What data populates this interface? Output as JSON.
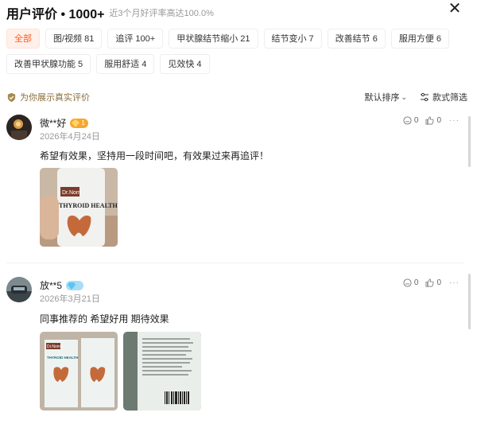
{
  "header": {
    "title": "用户评价 • 1000+",
    "subtitle": "近3个月好评率高达100.0%",
    "close_icon": "close-icon"
  },
  "tags": [
    {
      "label": "全部",
      "active": true
    },
    {
      "label": "图/视频 81"
    },
    {
      "label": "追评 100+"
    },
    {
      "label": "甲状腺结节缩小 21"
    },
    {
      "label": "结节变小 7"
    },
    {
      "label": "改善结节 6"
    },
    {
      "label": "服用方便 6"
    },
    {
      "label": "改善甲状腺功能 5"
    },
    {
      "label": "服用舒适 4"
    },
    {
      "label": "见效快 4"
    }
  ],
  "verify_text": "为你展示真实评价",
  "sort_label": "默认排序",
  "filter_label": "款式筛选",
  "reviews": [
    {
      "username": "微**好",
      "badge": "1",
      "date": "2026年4月24日",
      "text": "希望有效果，坚持用一段时间吧，有效果过来再追评！",
      "dislike_count": "0",
      "like_count": "0",
      "photos": [
        {
          "brand": "Dr.Nom",
          "text": "THYROID HEALTH"
        }
      ]
    },
    {
      "username": "放**5",
      "badge": "",
      "date": "2026年3月21日",
      "text": "同事推荐的 希望好用 期待效果",
      "dislike_count": "0",
      "like_count": "0",
      "photos": [
        {
          "brand": "Dr.Nom",
          "text": "THYROID HEALTH"
        },
        {
          "brand": "",
          "text": ""
        }
      ]
    }
  ],
  "colors": {
    "accent": "#ff5a1f",
    "accent_bg": "#fff0ea",
    "muted": "#999999"
  }
}
